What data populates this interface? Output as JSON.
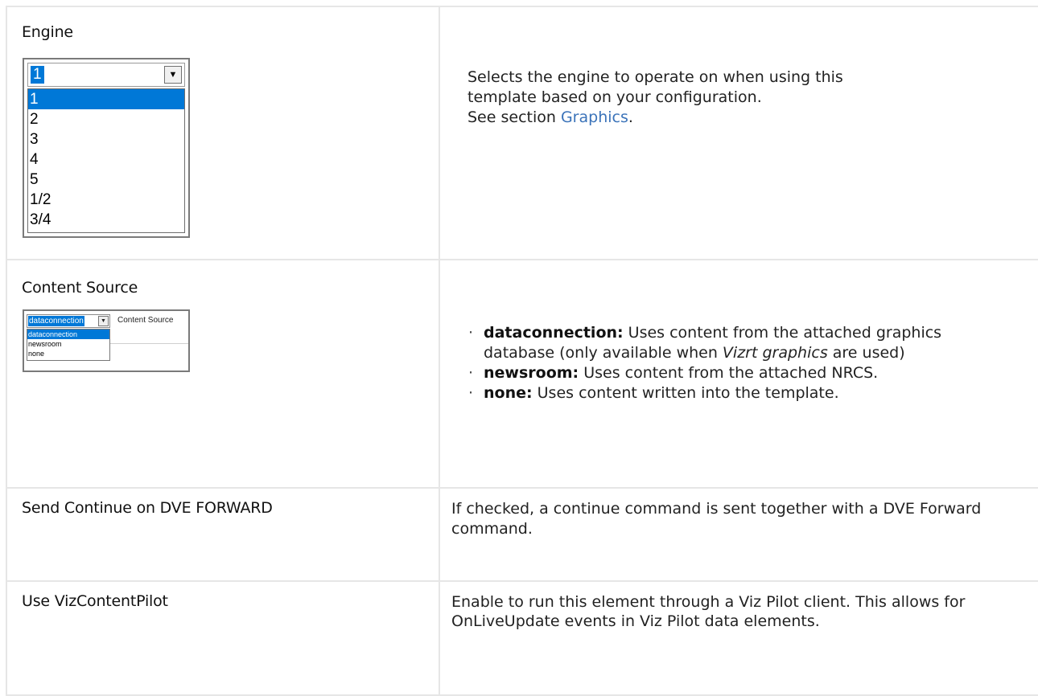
{
  "rows": {
    "engine": {
      "label": "Engine",
      "combo": {
        "selected": "1",
        "dropdown_icon": "chevron-down-icon",
        "options": [
          "1",
          "2",
          "3",
          "4",
          "5",
          "1/2",
          "3/4"
        ]
      },
      "description": {
        "line1": "Selects the engine to operate on when using this",
        "line2": "template based on your configuration.",
        "see_prefix": "See section ",
        "see_link": "Graphics",
        "see_suffix": "."
      }
    },
    "content_source": {
      "label": "Content Source",
      "widget": {
        "selected": "dataconnection",
        "field_label": "Content Source",
        "options": [
          "dataconnection",
          "newsroom",
          "none"
        ]
      },
      "bullets": [
        {
          "term": "dataconnection:",
          "text_a": " Uses content from the attached graphics database (only available when ",
          "emphasis": "Vizrt graphics",
          "text_b": " are used)"
        },
        {
          "term": "newsroom:",
          "text_a": " Uses content from the attached NRCS."
        },
        {
          "term": "none:",
          "text_a": " Uses content written into the template."
        }
      ]
    },
    "dve_forward": {
      "label": "Send Continue on DVE FORWARD",
      "description": "If checked, a continue command is sent together with a DVE Forward command."
    },
    "vizcontentpilot": {
      "label": "Use VizContentPilot",
      "description": "Enable to run this element through a Viz Pilot client. This allows for OnLiveUpdate events in Viz Pilot data elements."
    }
  },
  "colors": {
    "link": "#3b73b9",
    "selection": "#0078d7",
    "border": "#e6e6e6"
  }
}
